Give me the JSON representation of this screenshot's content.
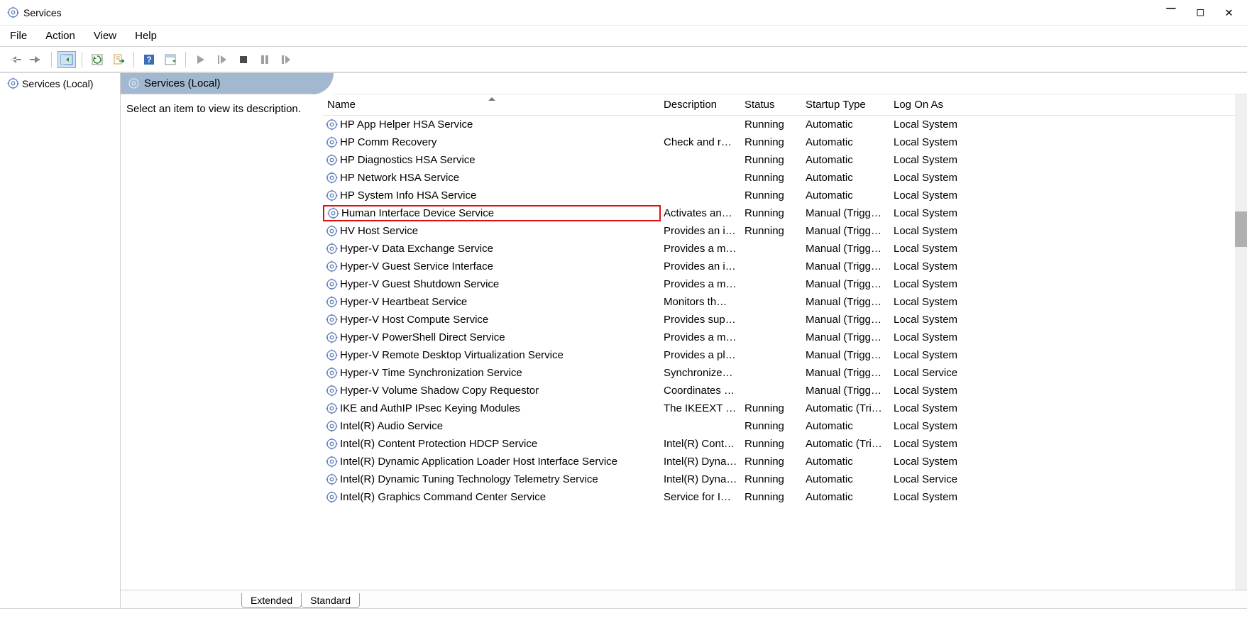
{
  "window": {
    "title": "Services"
  },
  "menu": [
    "File",
    "Action",
    "View",
    "Help"
  ],
  "tree": {
    "root": "Services (Local)"
  },
  "banner": "Services (Local)",
  "desc_panel": "Select an item to view its description.",
  "columns": {
    "name": "Name",
    "description": "Description",
    "status": "Status",
    "startup_type": "Startup Type",
    "log_on_as": "Log On As"
  },
  "tabs": {
    "extended": "Extended",
    "standard": "Standard"
  },
  "services": [
    {
      "name": "HP App Helper HSA Service",
      "description": "",
      "status": "Running",
      "startup": "Automatic",
      "logon": "Local System",
      "hl": false
    },
    {
      "name": "HP Comm Recovery",
      "description": "Check and r…",
      "status": "Running",
      "startup": "Automatic",
      "logon": "Local System",
      "hl": false
    },
    {
      "name": "HP Diagnostics HSA Service",
      "description": "",
      "status": "Running",
      "startup": "Automatic",
      "logon": "Local System",
      "hl": false
    },
    {
      "name": "HP Network HSA Service",
      "description": "",
      "status": "Running",
      "startup": "Automatic",
      "logon": "Local System",
      "hl": false
    },
    {
      "name": "HP System Info HSA Service",
      "description": "",
      "status": "Running",
      "startup": "Automatic",
      "logon": "Local System",
      "hl": false
    },
    {
      "name": "Human Interface Device Service",
      "description": "Activates an…",
      "status": "Running",
      "startup": "Manual (Trigg…",
      "logon": "Local System",
      "hl": true
    },
    {
      "name": "HV Host Service",
      "description": "Provides an i…",
      "status": "Running",
      "startup": "Manual (Trigg…",
      "logon": "Local System",
      "hl": false
    },
    {
      "name": "Hyper-V Data Exchange Service",
      "description": "Provides a m…",
      "status": "",
      "startup": "Manual (Trigg…",
      "logon": "Local System",
      "hl": false
    },
    {
      "name": "Hyper-V Guest Service Interface",
      "description": "Provides an i…",
      "status": "",
      "startup": "Manual (Trigg…",
      "logon": "Local System",
      "hl": false
    },
    {
      "name": "Hyper-V Guest Shutdown Service",
      "description": "Provides a m…",
      "status": "",
      "startup": "Manual (Trigg…",
      "logon": "Local System",
      "hl": false
    },
    {
      "name": "Hyper-V Heartbeat Service",
      "description": "Monitors th…",
      "status": "",
      "startup": "Manual (Trigg…",
      "logon": "Local System",
      "hl": false
    },
    {
      "name": "Hyper-V Host Compute Service",
      "description": "Provides sup…",
      "status": "",
      "startup": "Manual (Trigg…",
      "logon": "Local System",
      "hl": false
    },
    {
      "name": "Hyper-V PowerShell Direct Service",
      "description": "Provides a m…",
      "status": "",
      "startup": "Manual (Trigg…",
      "logon": "Local System",
      "hl": false
    },
    {
      "name": "Hyper-V Remote Desktop Virtualization Service",
      "description": "Provides a pl…",
      "status": "",
      "startup": "Manual (Trigg…",
      "logon": "Local System",
      "hl": false
    },
    {
      "name": "Hyper-V Time Synchronization Service",
      "description": "Synchronize…",
      "status": "",
      "startup": "Manual (Trigg…",
      "logon": "Local Service",
      "hl": false
    },
    {
      "name": "Hyper-V Volume Shadow Copy Requestor",
      "description": "Coordinates …",
      "status": "",
      "startup": "Manual (Trigg…",
      "logon": "Local System",
      "hl": false
    },
    {
      "name": "IKE and AuthIP IPsec Keying Modules",
      "description": "The IKEEXT s…",
      "status": "Running",
      "startup": "Automatic (Tri…",
      "logon": "Local System",
      "hl": false
    },
    {
      "name": "Intel(R) Audio Service",
      "description": "",
      "status": "Running",
      "startup": "Automatic",
      "logon": "Local System",
      "hl": false
    },
    {
      "name": "Intel(R) Content Protection HDCP Service",
      "description": "Intel(R) Cont…",
      "status": "Running",
      "startup": "Automatic (Tri…",
      "logon": "Local System",
      "hl": false
    },
    {
      "name": "Intel(R) Dynamic Application Loader Host Interface Service",
      "description": "Intel(R) Dyna…",
      "status": "Running",
      "startup": "Automatic",
      "logon": "Local System",
      "hl": false
    },
    {
      "name": "Intel(R) Dynamic Tuning Technology Telemetry Service",
      "description": "Intel(R) Dyna…",
      "status": "Running",
      "startup": "Automatic",
      "logon": "Local Service",
      "hl": false
    },
    {
      "name": "Intel(R) Graphics Command Center Service",
      "description": "Service for I…",
      "status": "Running",
      "startup": "Automatic",
      "logon": "Local System",
      "hl": false
    }
  ]
}
